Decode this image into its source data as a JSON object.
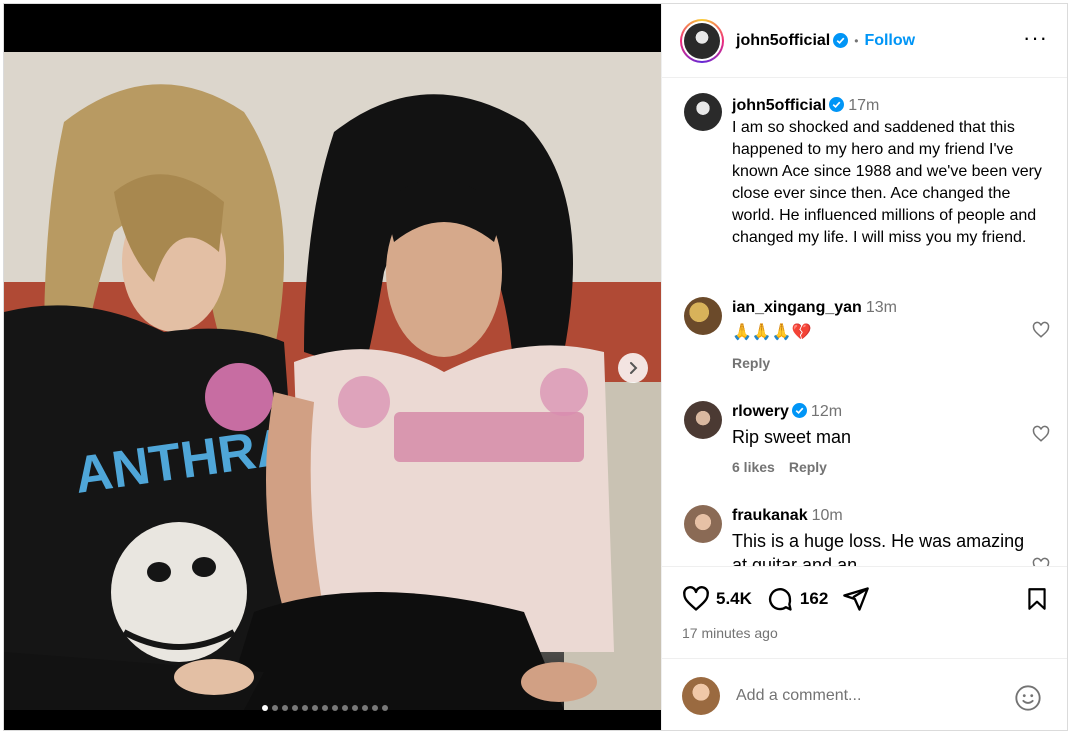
{
  "post": {
    "username": "john5official",
    "follow_label": "Follow",
    "separator": "•",
    "more_label": "···",
    "caption": {
      "username": "john5official",
      "time": "17m",
      "text": "I am so shocked and saddened that this happened to my hero and my friend I've known Ace since 1988 and we've been very close ever since then. Ace changed the world. He influenced millions of people and changed my life. I will miss you my friend."
    },
    "media": {
      "slides_total": 13,
      "active_slide": 1,
      "photo_text": "ANTHRAX"
    }
  },
  "comments": [
    {
      "username": "ian_xingang_yan",
      "time": "13m",
      "text": "🙏🙏🙏💔",
      "likes": "",
      "reply_label": "Reply",
      "verified": false
    },
    {
      "username": "rlowery",
      "time": "12m",
      "text": "Rip sweet man",
      "likes": "6 likes",
      "reply_label": "Reply",
      "verified": true
    },
    {
      "username": "fraukanak",
      "time": "10m",
      "text": "This is a huge loss. He was amazing at guitar and an",
      "likes": "",
      "reply_label": "",
      "verified": false
    }
  ],
  "actions": {
    "likes_count": "5.4K",
    "comments_count": "162",
    "posted_ago": "17 minutes ago"
  },
  "add_comment": {
    "placeholder": "Add a comment..."
  },
  "colors": {
    "accent": "#0095f6",
    "muted": "#737373",
    "border": "#efefef"
  },
  "icons": [
    "verified-badge-icon",
    "more-options-icon",
    "next-slide-icon",
    "heart-icon",
    "comment-icon",
    "share-icon",
    "bookmark-icon",
    "emoji-icon"
  ]
}
